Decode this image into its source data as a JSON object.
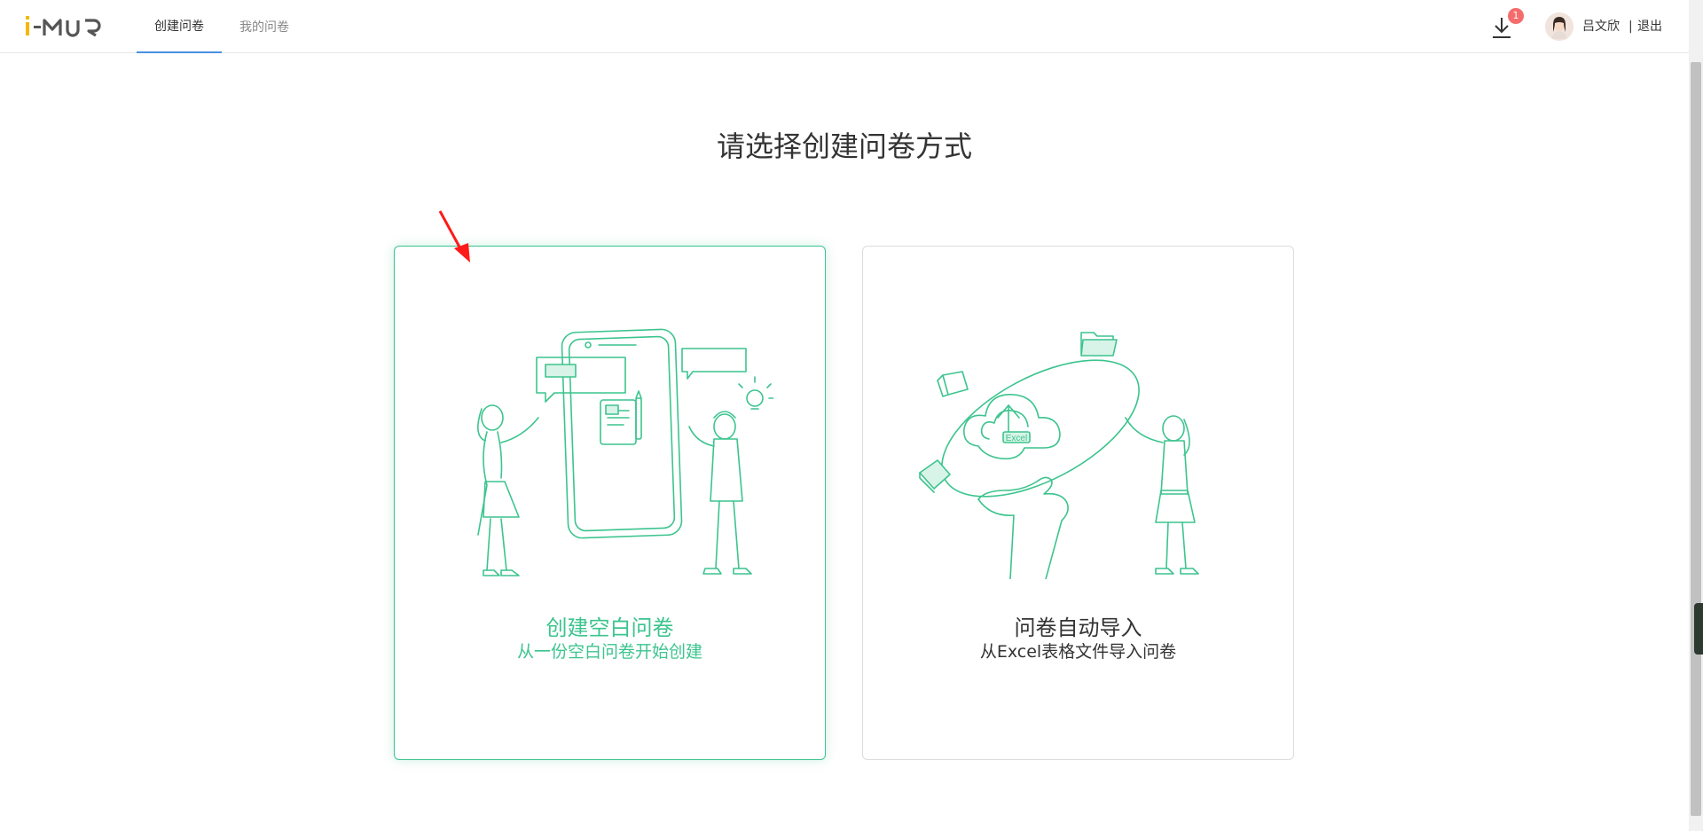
{
  "header": {
    "logo_text": "i-MUR",
    "tabs": [
      {
        "label": "创建问卷",
        "active": true
      },
      {
        "label": "我的问卷",
        "active": false
      }
    ],
    "download_badge": "1",
    "user_name": "吕文欣",
    "separator": "|",
    "logout_label": "退出"
  },
  "main": {
    "title": "请选择创建问卷方式",
    "cards": [
      {
        "title": "创建空白问卷",
        "subtitle": "从一份空白问卷开始创建",
        "selected": true
      },
      {
        "title": "问卷自动导入",
        "subtitle": "从Excel表格文件导入问卷",
        "selected": false,
        "illustration_label": "Excel"
      }
    ]
  },
  "colors": {
    "accent_green": "#3cc48e",
    "tab_underline": "#4a90e2",
    "badge_red": "#f56c6c",
    "logo_yellow": "#f5b800"
  }
}
